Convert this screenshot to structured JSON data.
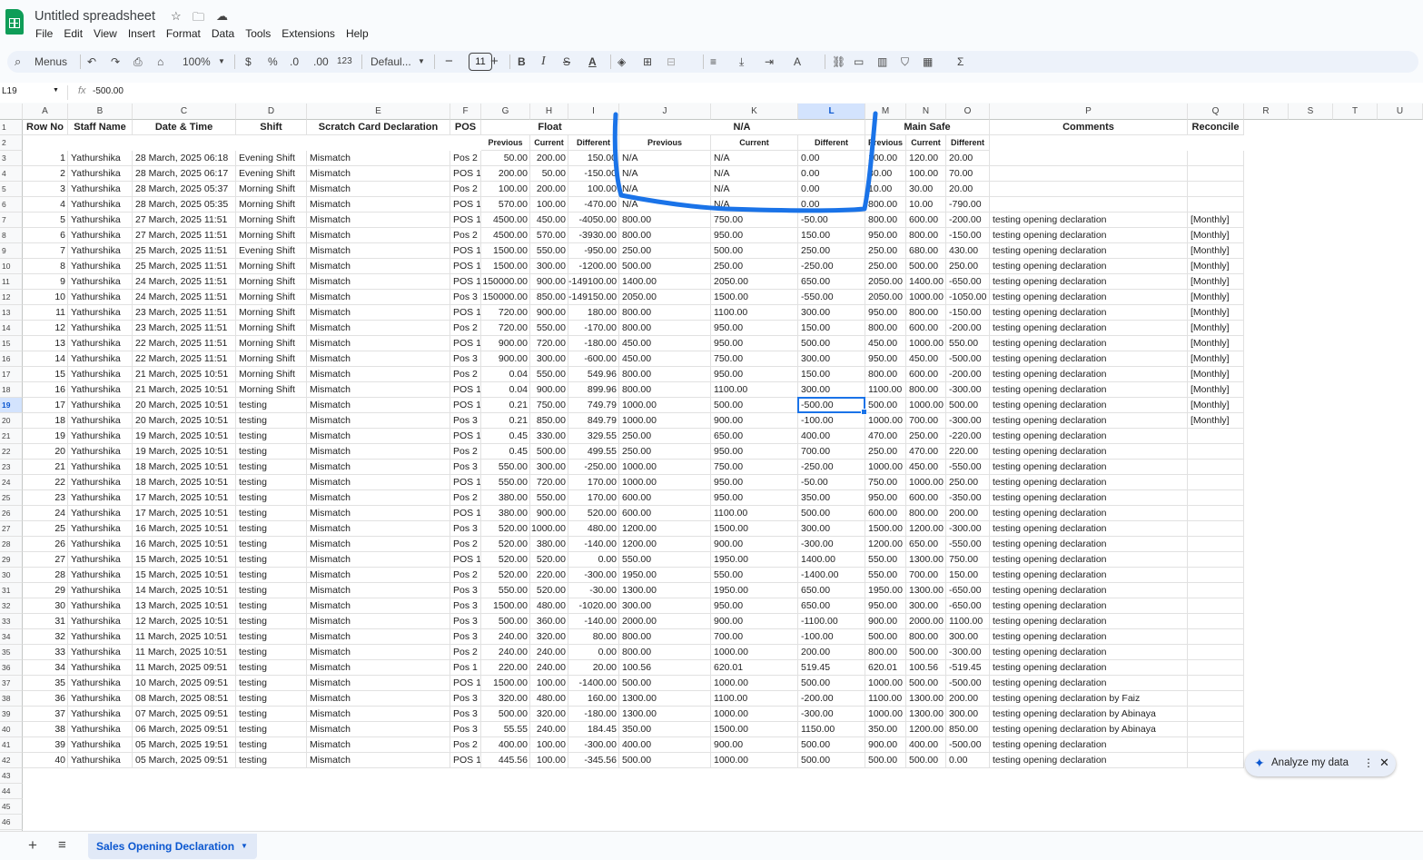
{
  "app": {
    "title": "Untitled spreadsheet",
    "menus": [
      "File",
      "Edit",
      "View",
      "Insert",
      "Format",
      "Data",
      "Tools",
      "Extensions",
      "Help"
    ]
  },
  "toolbar": {
    "search_label": "Menus",
    "zoom": "100%",
    "currency": "$",
    "percent": "%",
    "dec_decrease": ".0",
    "dec_increase": ".00",
    "number_format": "123",
    "font": "Defaul...",
    "font_size": "11",
    "bold": "B",
    "italic": "I"
  },
  "formula_bar": {
    "cell_ref": "L19",
    "fx": "fx",
    "formula": "-500.00"
  },
  "columns": [
    "A",
    "B",
    "C",
    "D",
    "E",
    "F",
    "G",
    "H",
    "I",
    "J",
    "K",
    "L",
    "M",
    "N",
    "O",
    "P",
    "Q",
    "R",
    "S",
    "T",
    "U"
  ],
  "selected_column": "L",
  "selected_row": 19,
  "header_row": {
    "A": "Row No",
    "B": "Staff Name",
    "C": "Date & Time",
    "D": "Shift",
    "E": "Scratch Card Declaration",
    "F": "POS",
    "GI": "Float",
    "JL": "N/A",
    "MO": "Main Safe",
    "P": "Comments",
    "Q": "Reconcile"
  },
  "sub_header_row": [
    "Previous",
    "Current",
    "Different",
    "Previous",
    "Current",
    "Different",
    "Previous",
    "Current",
    "Different"
  ],
  "rows": [
    [
      "1",
      "Yathurshika",
      "28 March, 2025 06:18",
      "Evening Shift",
      "Mismatch",
      "Pos 2",
      "50.00",
      "200.00",
      "150.00",
      "N/A",
      "N/A",
      "0.00",
      "100.00",
      "120.00",
      "20.00",
      "",
      ""
    ],
    [
      "2",
      "Yathurshika",
      "28 March, 2025 06:17",
      "Evening Shift",
      "Mismatch",
      "POS 1",
      "200.00",
      "50.00",
      "-150.00",
      "N/A",
      "N/A",
      "0.00",
      "30.00",
      "100.00",
      "70.00",
      "",
      ""
    ],
    [
      "3",
      "Yathurshika",
      "28 March, 2025 05:37",
      "Morning Shift",
      "Mismatch",
      "Pos 2",
      "100.00",
      "200.00",
      "100.00",
      "N/A",
      "N/A",
      "0.00",
      "10.00",
      "30.00",
      "20.00",
      "",
      ""
    ],
    [
      "4",
      "Yathurshika",
      "28 March, 2025 05:35",
      "Morning Shift",
      "Mismatch",
      "POS 1",
      "570.00",
      "100.00",
      "-470.00",
      "N/A",
      "N/A",
      "0.00",
      "800.00",
      "10.00",
      "-790.00",
      "",
      ""
    ],
    [
      "5",
      "Yathurshika",
      "27 March, 2025 11:51",
      "Morning Shift",
      "Mismatch",
      "POS 1",
      "4500.00",
      "450.00",
      "-4050.00",
      "800.00",
      "750.00",
      "-50.00",
      "800.00",
      "600.00",
      "-200.00",
      "testing opening declaration",
      "[Monthly]"
    ],
    [
      "6",
      "Yathurshika",
      "27 March, 2025 11:51",
      "Morning Shift",
      "Mismatch",
      "Pos 2",
      "4500.00",
      "570.00",
      "-3930.00",
      "800.00",
      "950.00",
      "150.00",
      "950.00",
      "800.00",
      "-150.00",
      "testing opening declaration",
      "[Monthly]"
    ],
    [
      "7",
      "Yathurshika",
      "25 March, 2025 11:51",
      "Evening Shift",
      "Mismatch",
      "POS 1",
      "1500.00",
      "550.00",
      "-950.00",
      "250.00",
      "500.00",
      "250.00",
      "250.00",
      "680.00",
      "430.00",
      "testing opening declaration",
      "[Monthly]"
    ],
    [
      "8",
      "Yathurshika",
      "25 March, 2025 11:51",
      "Morning Shift",
      "Mismatch",
      "POS 1",
      "1500.00",
      "300.00",
      "-1200.00",
      "500.00",
      "250.00",
      "-250.00",
      "250.00",
      "500.00",
      "250.00",
      "testing opening declaration",
      "[Monthly]"
    ],
    [
      "9",
      "Yathurshika",
      "24 March, 2025 11:51",
      "Morning Shift",
      "Mismatch",
      "POS 1",
      "150000.00",
      "900.00",
      "-149100.00",
      "1400.00",
      "2050.00",
      "650.00",
      "2050.00",
      "1400.00",
      "-650.00",
      "testing opening declaration",
      "[Monthly]"
    ],
    [
      "10",
      "Yathurshika",
      "24 March, 2025 11:51",
      "Morning Shift",
      "Mismatch",
      "Pos 3",
      "150000.00",
      "850.00",
      "-149150.00",
      "2050.00",
      "1500.00",
      "-550.00",
      "2050.00",
      "1000.00",
      "-1050.00",
      "testing opening declaration",
      "[Monthly]"
    ],
    [
      "11",
      "Yathurshika",
      "23 March, 2025 11:51",
      "Morning Shift",
      "Mismatch",
      "POS 1",
      "720.00",
      "900.00",
      "180.00",
      "800.00",
      "1100.00",
      "300.00",
      "950.00",
      "800.00",
      "-150.00",
      "testing opening declaration",
      "[Monthly]"
    ],
    [
      "12",
      "Yathurshika",
      "23 March, 2025 11:51",
      "Morning Shift",
      "Mismatch",
      "Pos 2",
      "720.00",
      "550.00",
      "-170.00",
      "800.00",
      "950.00",
      "150.00",
      "800.00",
      "600.00",
      "-200.00",
      "testing opening declaration",
      "[Monthly]"
    ],
    [
      "13",
      "Yathurshika",
      "22 March, 2025 11:51",
      "Morning Shift",
      "Mismatch",
      "POS 1",
      "900.00",
      "720.00",
      "-180.00",
      "450.00",
      "950.00",
      "500.00",
      "450.00",
      "1000.00",
      "550.00",
      "testing opening declaration",
      "[Monthly]"
    ],
    [
      "14",
      "Yathurshika",
      "22 March, 2025 11:51",
      "Morning Shift",
      "Mismatch",
      "Pos 3",
      "900.00",
      "300.00",
      "-600.00",
      "450.00",
      "750.00",
      "300.00",
      "950.00",
      "450.00",
      "-500.00",
      "testing opening declaration",
      "[Monthly]"
    ],
    [
      "15",
      "Yathurshika",
      "21 March, 2025 10:51",
      "Morning Shift",
      "Mismatch",
      "Pos 2",
      "0.04",
      "550.00",
      "549.96",
      "800.00",
      "950.00",
      "150.00",
      "800.00",
      "600.00",
      "-200.00",
      "testing opening declaration",
      "[Monthly]"
    ],
    [
      "16",
      "Yathurshika",
      "21 March, 2025 10:51",
      "Morning Shift",
      "Mismatch",
      "POS 1",
      "0.04",
      "900.00",
      "899.96",
      "800.00",
      "1100.00",
      "300.00",
      "1100.00",
      "800.00",
      "-300.00",
      "testing opening declaration",
      "[Monthly]"
    ],
    [
      "17",
      "Yathurshika",
      "20 March, 2025 10:51",
      "testing",
      "Mismatch",
      "POS 1",
      "0.21",
      "750.00",
      "749.79",
      "1000.00",
      "500.00",
      "-500.00",
      "500.00",
      "1000.00",
      "500.00",
      "testing opening declaration",
      "[Monthly]"
    ],
    [
      "18",
      "Yathurshika",
      "20 March, 2025 10:51",
      "testing",
      "Mismatch",
      "Pos 3",
      "0.21",
      "850.00",
      "849.79",
      "1000.00",
      "900.00",
      "-100.00",
      "1000.00",
      "700.00",
      "-300.00",
      "testing opening declaration",
      "[Monthly]"
    ],
    [
      "19",
      "Yathurshika",
      "19 March, 2025 10:51",
      "testing",
      "Mismatch",
      "POS 1",
      "0.45",
      "330.00",
      "329.55",
      "250.00",
      "650.00",
      "400.00",
      "470.00",
      "250.00",
      "-220.00",
      "testing opening declaration",
      ""
    ],
    [
      "20",
      "Yathurshika",
      "19 March, 2025 10:51",
      "testing",
      "Mismatch",
      "Pos 2",
      "0.45",
      "500.00",
      "499.55",
      "250.00",
      "950.00",
      "700.00",
      "250.00",
      "470.00",
      "220.00",
      "testing opening declaration",
      ""
    ],
    [
      "21",
      "Yathurshika",
      "18 March, 2025 10:51",
      "testing",
      "Mismatch",
      "Pos 3",
      "550.00",
      "300.00",
      "-250.00",
      "1000.00",
      "750.00",
      "-250.00",
      "1000.00",
      "450.00",
      "-550.00",
      "testing opening declaration",
      ""
    ],
    [
      "22",
      "Yathurshika",
      "18 March, 2025 10:51",
      "testing",
      "Mismatch",
      "POS 1",
      "550.00",
      "720.00",
      "170.00",
      "1000.00",
      "950.00",
      "-50.00",
      "750.00",
      "1000.00",
      "250.00",
      "testing opening declaration",
      ""
    ],
    [
      "23",
      "Yathurshika",
      "17 March, 2025 10:51",
      "testing",
      "Mismatch",
      "Pos 2",
      "380.00",
      "550.00",
      "170.00",
      "600.00",
      "950.00",
      "350.00",
      "950.00",
      "600.00",
      "-350.00",
      "testing opening declaration",
      ""
    ],
    [
      "24",
      "Yathurshika",
      "17 March, 2025 10:51",
      "testing",
      "Mismatch",
      "POS 1",
      "380.00",
      "900.00",
      "520.00",
      "600.00",
      "1100.00",
      "500.00",
      "600.00",
      "800.00",
      "200.00",
      "testing opening declaration",
      ""
    ],
    [
      "25",
      "Yathurshika",
      "16 March, 2025 10:51",
      "testing",
      "Mismatch",
      "Pos 3",
      "520.00",
      "1000.00",
      "480.00",
      "1200.00",
      "1500.00",
      "300.00",
      "1500.00",
      "1200.00",
      "-300.00",
      "testing opening declaration",
      ""
    ],
    [
      "26",
      "Yathurshika",
      "16 March, 2025 10:51",
      "testing",
      "Mismatch",
      "Pos 2",
      "520.00",
      "380.00",
      "-140.00",
      "1200.00",
      "900.00",
      "-300.00",
      "1200.00",
      "650.00",
      "-550.00",
      "testing opening declaration",
      ""
    ],
    [
      "27",
      "Yathurshika",
      "15 March, 2025 10:51",
      "testing",
      "Mismatch",
      "POS 1",
      "520.00",
      "520.00",
      "0.00",
      "550.00",
      "1950.00",
      "1400.00",
      "550.00",
      "1300.00",
      "750.00",
      "testing opening declaration",
      ""
    ],
    [
      "28",
      "Yathurshika",
      "15 March, 2025 10:51",
      "testing",
      "Mismatch",
      "Pos 2",
      "520.00",
      "220.00",
      "-300.00",
      "1950.00",
      "550.00",
      "-1400.00",
      "550.00",
      "700.00",
      "150.00",
      "testing opening declaration",
      ""
    ],
    [
      "29",
      "Yathurshika",
      "14 March, 2025 10:51",
      "testing",
      "Mismatch",
      "Pos 3",
      "550.00",
      "520.00",
      "-30.00",
      "1300.00",
      "1950.00",
      "650.00",
      "1950.00",
      "1300.00",
      "-650.00",
      "testing opening declaration",
      ""
    ],
    [
      "30",
      "Yathurshika",
      "13 March, 2025 10:51",
      "testing",
      "Mismatch",
      "Pos 3",
      "1500.00",
      "480.00",
      "-1020.00",
      "300.00",
      "950.00",
      "650.00",
      "950.00",
      "300.00",
      "-650.00",
      "testing opening declaration",
      ""
    ],
    [
      "31",
      "Yathurshika",
      "12 March, 2025 10:51",
      "testing",
      "Mismatch",
      "Pos 3",
      "500.00",
      "360.00",
      "-140.00",
      "2000.00",
      "900.00",
      "-1100.00",
      "900.00",
      "2000.00",
      "1100.00",
      "testing opening declaration",
      ""
    ],
    [
      "32",
      "Yathurshika",
      "11 March, 2025 10:51",
      "testing",
      "Mismatch",
      "Pos 3",
      "240.00",
      "320.00",
      "80.00",
      "800.00",
      "700.00",
      "-100.00",
      "500.00",
      "800.00",
      "300.00",
      "testing opening declaration",
      ""
    ],
    [
      "33",
      "Yathurshika",
      "11 March, 2025 10:51",
      "testing",
      "Mismatch",
      "Pos 2",
      "240.00",
      "240.00",
      "0.00",
      "800.00",
      "1000.00",
      "200.00",
      "800.00",
      "500.00",
      "-300.00",
      "testing opening declaration",
      ""
    ],
    [
      "34",
      "Yathurshika",
      "11 March, 2025 09:51",
      "testing",
      "Mismatch",
      "Pos 1",
      "220.00",
      "240.00",
      "20.00",
      "100.56",
      "620.01",
      "519.45",
      "620.01",
      "100.56",
      "-519.45",
      "testing opening declaration",
      ""
    ],
    [
      "35",
      "Yathurshika",
      "10 March, 2025 09:51",
      "testing",
      "Mismatch",
      "POS 1",
      "1500.00",
      "100.00",
      "-1400.00",
      "500.00",
      "1000.00",
      "500.00",
      "1000.00",
      "500.00",
      "-500.00",
      "testing opening declaration",
      ""
    ],
    [
      "36",
      "Yathurshika",
      "08 March, 2025 08:51",
      "testing",
      "Mismatch",
      "Pos 3",
      "320.00",
      "480.00",
      "160.00",
      "1300.00",
      "1100.00",
      "-200.00",
      "1100.00",
      "1300.00",
      "200.00",
      "testing opening declaration by Faiz",
      ""
    ],
    [
      "37",
      "Yathurshika",
      "07 March, 2025 09:51",
      "testing",
      "Mismatch",
      "Pos 3",
      "500.00",
      "320.00",
      "-180.00",
      "1300.00",
      "1000.00",
      "-300.00",
      "1000.00",
      "1300.00",
      "300.00",
      "testing opening declaration by Abinaya",
      ""
    ],
    [
      "38",
      "Yathurshika",
      "06 March, 2025 09:51",
      "testing",
      "Mismatch",
      "Pos 3",
      "55.55",
      "240.00",
      "184.45",
      "350.00",
      "1500.00",
      "1150.00",
      "350.00",
      "1200.00",
      "850.00",
      "testing opening declaration by Abinaya",
      ""
    ],
    [
      "39",
      "Yathurshika",
      "05 March, 2025 19:51",
      "testing",
      "Mismatch",
      "Pos 2",
      "400.00",
      "100.00",
      "-300.00",
      "400.00",
      "900.00",
      "500.00",
      "900.00",
      "400.00",
      "-500.00",
      "testing opening declaration",
      ""
    ],
    [
      "40",
      "Yathurshika",
      "05 March, 2025 09:51",
      "testing",
      "Mismatch",
      "POS 1",
      "445.56",
      "100.00",
      "-345.56",
      "500.00",
      "1000.00",
      "500.00",
      "500.00",
      "500.00",
      "0.00",
      "testing opening declaration",
      ""
    ]
  ],
  "analyze_button": {
    "label": "Analyze my data"
  },
  "sheet_tab": {
    "label": "Sales Opening Declaration"
  },
  "colors": {
    "accent": "#0b57d0",
    "annotation": "#1a73e8",
    "logo": "#0f9d58"
  }
}
